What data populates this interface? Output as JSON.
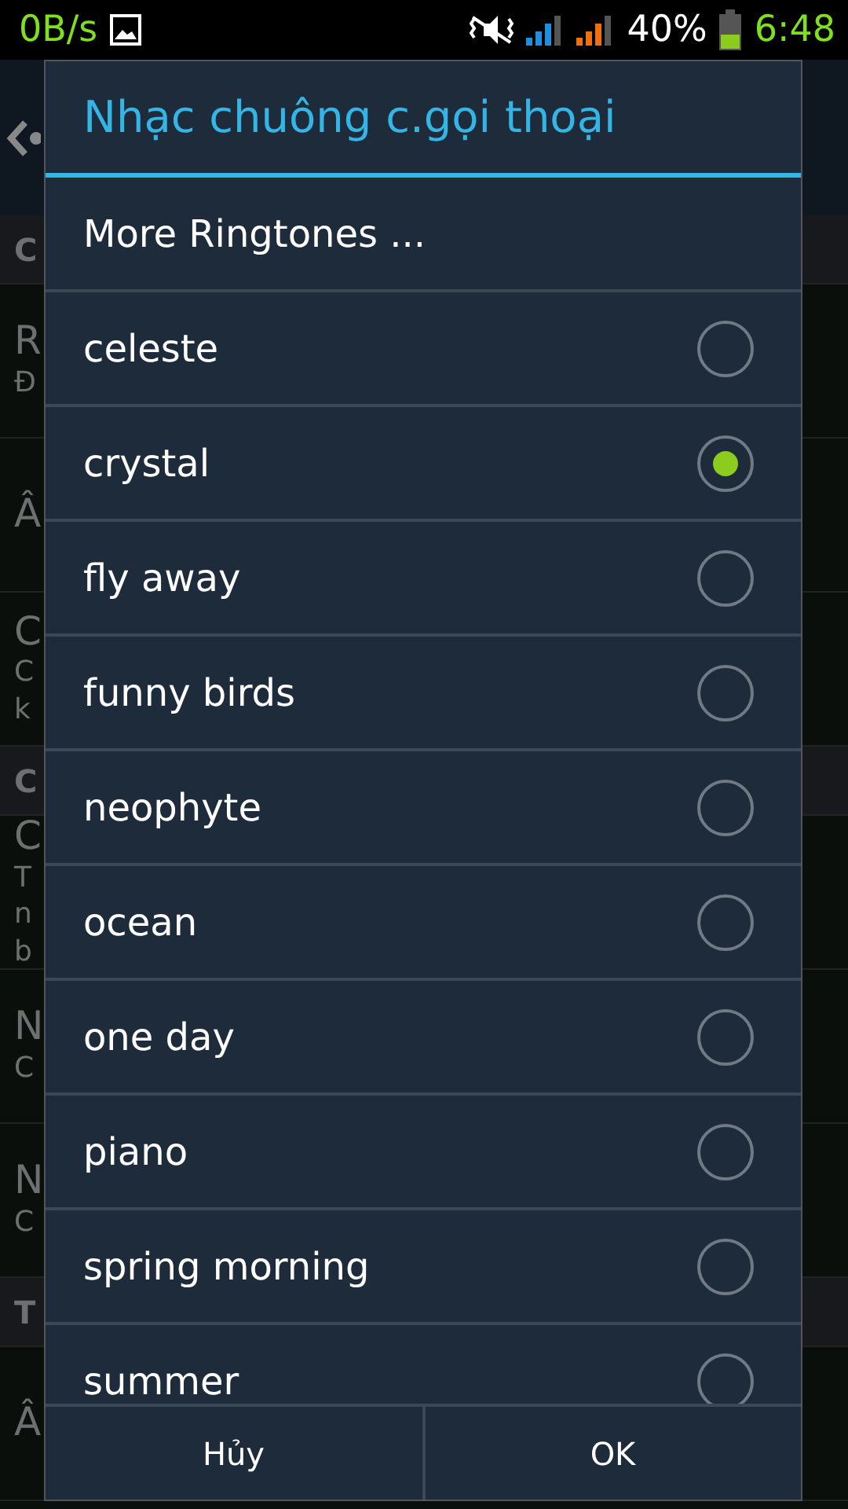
{
  "status_bar": {
    "speed": "0B/s",
    "battery_percent": "40%",
    "time": "6:48"
  },
  "background": {
    "rows": [
      {
        "kind": "header",
        "texts": [
          "C"
        ]
      },
      {
        "kind": "item",
        "texts": [
          "R",
          "Đ"
        ]
      },
      {
        "kind": "item",
        "texts": [
          "Â"
        ]
      },
      {
        "kind": "item",
        "texts": [
          "C",
          "C",
          "k"
        ]
      },
      {
        "kind": "header",
        "texts": [
          "C"
        ]
      },
      {
        "kind": "item",
        "texts": [
          "C",
          "T",
          "n",
          "b"
        ]
      },
      {
        "kind": "item",
        "texts": [
          "N",
          "C"
        ]
      },
      {
        "kind": "item",
        "texts": [
          "N",
          "C"
        ]
      },
      {
        "kind": "header",
        "texts": [
          "T"
        ]
      },
      {
        "kind": "item",
        "texts": [
          "Â"
        ]
      }
    ]
  },
  "dialog": {
    "title": "Nhạc chuông c.gọi thoại",
    "items": [
      {
        "kind": "action",
        "label": "More Ringtones ..."
      },
      {
        "kind": "radio",
        "label": "celeste",
        "selected": false
      },
      {
        "kind": "radio",
        "label": "crystal",
        "selected": true
      },
      {
        "kind": "radio",
        "label": "fly away",
        "selected": false
      },
      {
        "kind": "radio",
        "label": "funny birds",
        "selected": false
      },
      {
        "kind": "radio",
        "label": "neophyte",
        "selected": false
      },
      {
        "kind": "radio",
        "label": "ocean",
        "selected": false
      },
      {
        "kind": "radio",
        "label": "one day",
        "selected": false
      },
      {
        "kind": "radio",
        "label": "piano",
        "selected": false
      },
      {
        "kind": "radio",
        "label": "spring morning",
        "selected": false
      },
      {
        "kind": "radio",
        "label": "summer",
        "selected": false
      }
    ],
    "buttons": [
      "Hủy",
      "OK"
    ]
  }
}
